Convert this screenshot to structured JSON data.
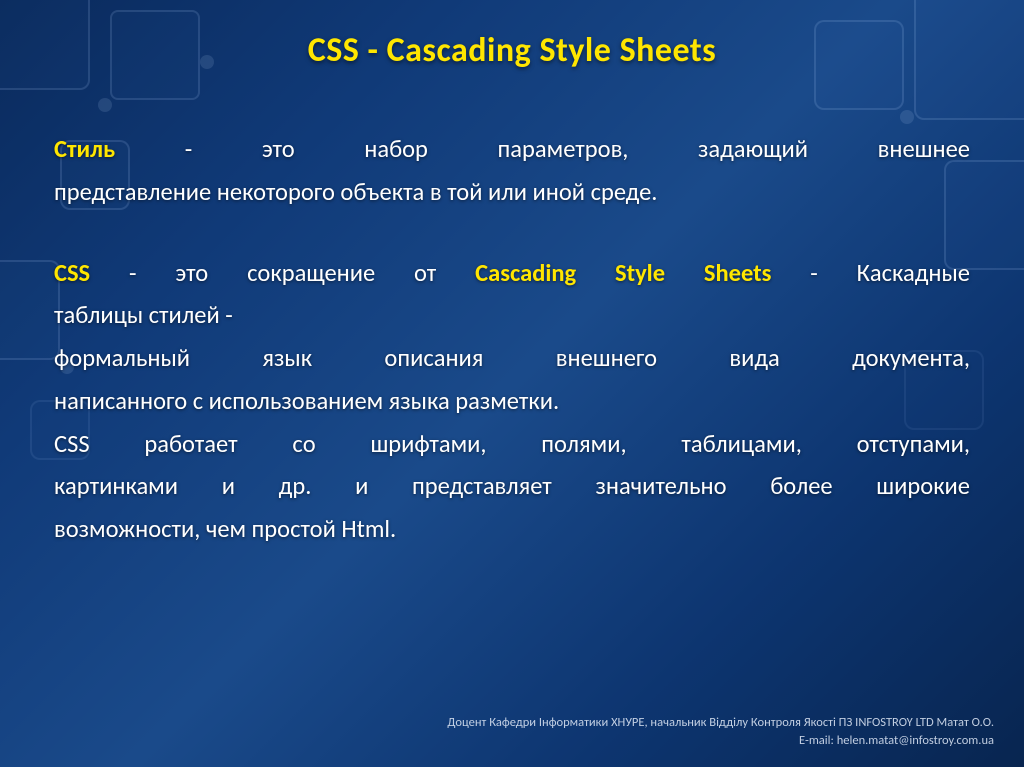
{
  "title": "CSS - Cascading Style Sheets",
  "kw": {
    "style": "Стиль",
    "css": "CSS",
    "casc": "Cascading Style Sheets"
  },
  "para1": {
    "line1_rest": " - это набор параметров, задающий внешнее",
    "line2": "представление некоторого объекта в той или иной среде."
  },
  "para2": {
    "line1_a": " - это сокращение от ",
    "line1_b": " - Каскадные",
    "line2": "таблицы стилей -"
  },
  "para3": {
    "line1": "формальный язык описания внешнего вида документа,",
    "line2": "написанного с использованием языка разметки."
  },
  "para4": {
    "line1": "CSS работает со шрифтами, полями, таблицами, отступами,",
    "line2": "картинками и др. и представляет значительно более широкие",
    "line3": "возможности, чем простой Html."
  },
  "footer": {
    "line1": "Доцент Кафедри Інформатики ХНУРЕ, начальник Відділу Контроля Якості ПЗ INFOSTROY LTD Матат О.О.",
    "line2": "E-mail: helen.matat@infostroy.com.ua"
  }
}
